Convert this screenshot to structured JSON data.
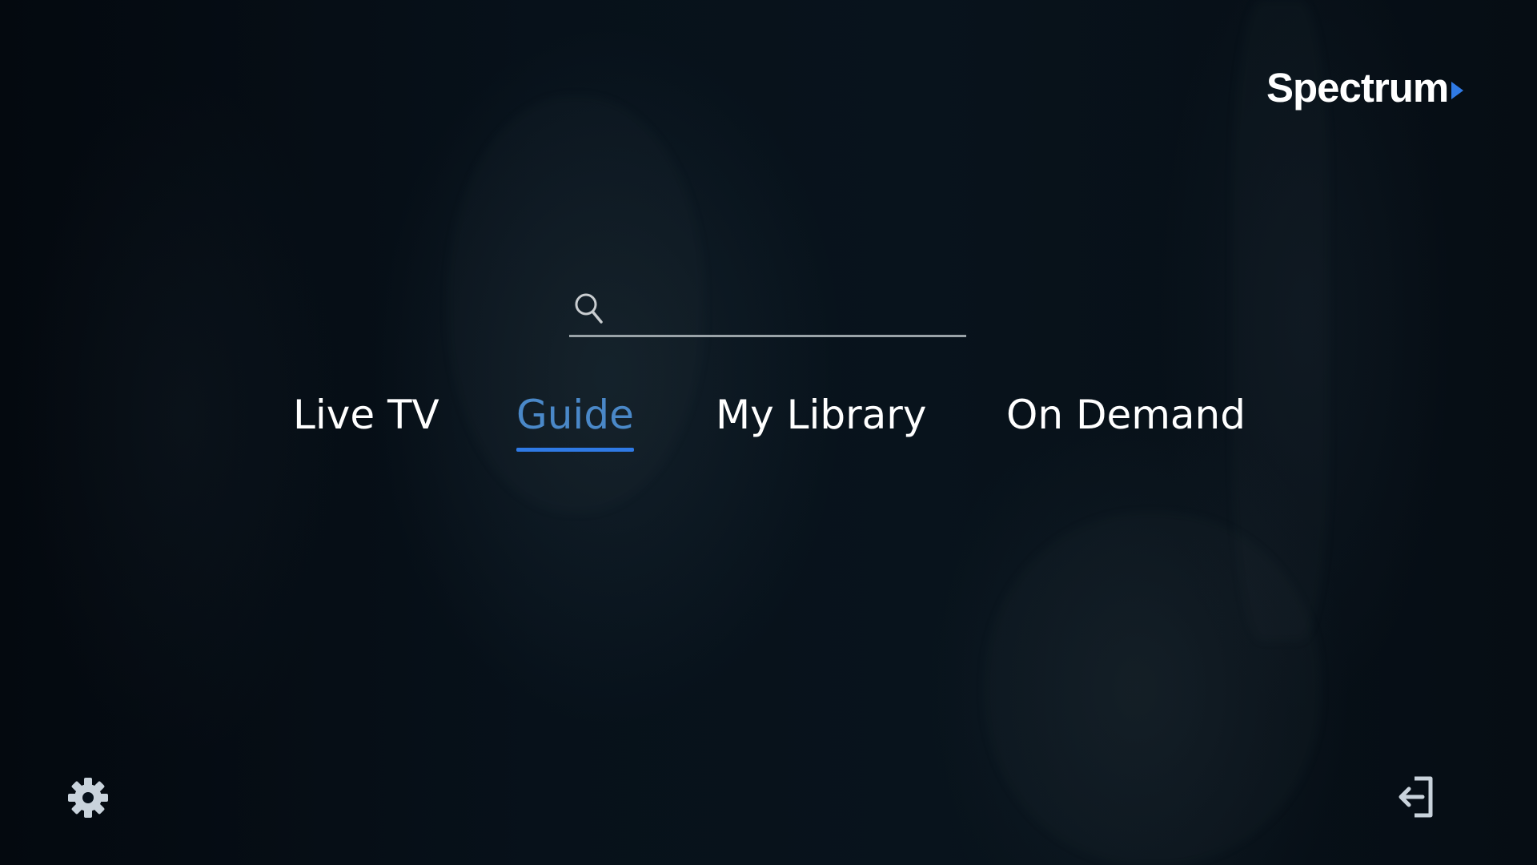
{
  "app": {
    "brand": "Spectrum",
    "accent_color": "#2f7ae5"
  },
  "search": {
    "value": "",
    "placeholder": "",
    "icon": "search-icon"
  },
  "nav": {
    "items": [
      {
        "label": "Live TV",
        "active": false
      },
      {
        "label": "Guide",
        "active": true
      },
      {
        "label": "My Library",
        "active": false
      },
      {
        "label": "On Demand",
        "active": false
      }
    ]
  },
  "footer": {
    "settings_icon": "gear-icon",
    "exit_icon": "sign-out-icon"
  }
}
